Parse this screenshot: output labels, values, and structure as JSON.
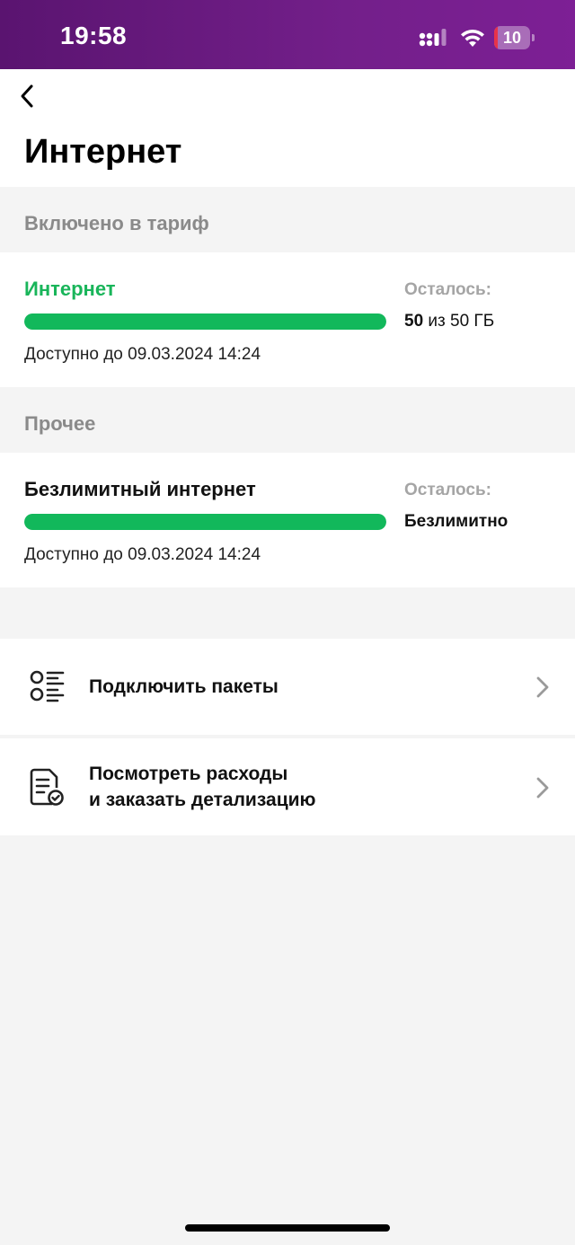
{
  "status_bar": {
    "time": "19:58",
    "battery_level": "10",
    "battery_fraction": 0.1,
    "battery_color": "#e8334a"
  },
  "header": {
    "back_icon": "chevron-left-icon",
    "title": "Интернет"
  },
  "sections": {
    "included_label": "Включено в тариф",
    "other_label": "Прочее"
  },
  "packages": [
    {
      "name": "Интернет",
      "name_color": "#19b55a",
      "remaining_label": "Осталось:",
      "remaining_amount": "50",
      "remaining_of": " из 50 ГБ",
      "progress_fraction": 1.0,
      "available_until": "Доступно до 09.03.2024 14:24"
    },
    {
      "name": "Безлимитный интернет",
      "remaining_label": "Осталось:",
      "remaining_amount": "Безлимитно",
      "progress_fraction": 1.0,
      "available_until": "Доступно до 09.03.2024 14:24"
    }
  ],
  "menu": [
    {
      "icon": "list-options-icon",
      "label": "Подключить пакеты"
    },
    {
      "icon": "document-check-icon",
      "label_line1": "Посмотреть расходы",
      "label_line2": "и заказать детализацию"
    }
  ],
  "colors": {
    "accent_green": "#12b85b",
    "status_bar_purple": "#731f8a"
  }
}
